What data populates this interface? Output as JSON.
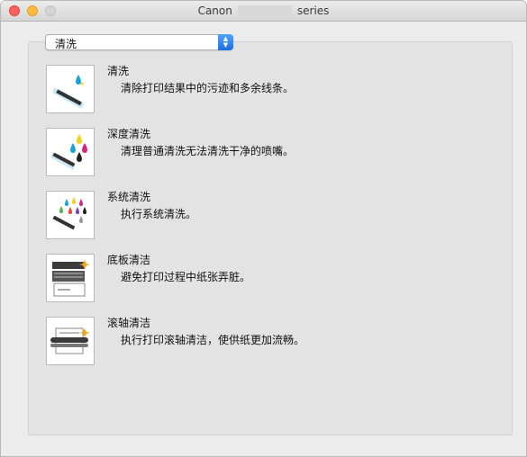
{
  "window": {
    "title_left": "Canon",
    "title_right": "series"
  },
  "popup": {
    "selected": "清洗"
  },
  "items": [
    {
      "title": "清洗",
      "desc": "清除打印结果中的污迹和多余线条。",
      "icon": "cleaning-icon"
    },
    {
      "title": "深度清洗",
      "desc": "清理普通清洗无法清洗干净的喷嘴。",
      "icon": "deep-cleaning-icon"
    },
    {
      "title": "系统清洗",
      "desc": "执行系统清洗。",
      "icon": "system-cleaning-icon"
    },
    {
      "title": "底板清洁",
      "desc": "避免打印过程中纸张弄脏。",
      "icon": "bottom-plate-cleaning-icon"
    },
    {
      "title": "滚轴清洁",
      "desc": "执行打印滚轴清洁，使供纸更加流畅。",
      "icon": "roller-cleaning-icon"
    }
  ],
  "colors": {
    "close": "#fc605c",
    "minimize": "#fdbc40",
    "zoom": "#d4d4d4",
    "popup_accent": "#2b7ff0",
    "ink_cyan": "#1aa3d9",
    "ink_magenta": "#d6247b",
    "ink_yellow": "#f2d21b",
    "ink_black": "#222222"
  }
}
